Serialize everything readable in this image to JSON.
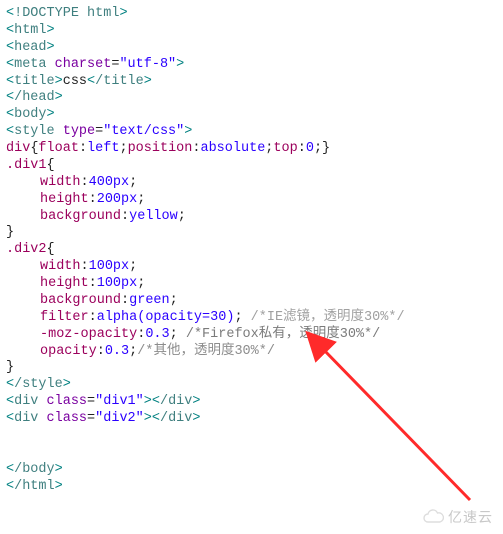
{
  "line01_a": "<",
  "line01_b": "!DOCTYPE html",
  "line01_c": ">",
  "line02_a": "<",
  "line02_b": "html",
  "line02_c": ">",
  "line03_a": "<",
  "line03_b": "head",
  "line03_c": ">",
  "line04_a": "<",
  "line04_b": "meta ",
  "line04_c": "charset",
  "line04_d": "=",
  "line04_e": "\"utf-8\"",
  "line04_f": ">",
  "line05_a": "<",
  "line05_b": "title",
  "line05_c": ">",
  "line05_d": "css",
  "line05_e": "<",
  "line05_f": "/title",
  "line05_g": ">",
  "line06_a": "<",
  "line06_b": "/head",
  "line06_c": ">",
  "line07_a": "<",
  "line07_b": "body",
  "line07_c": ">",
  "line08_a": "<",
  "line08_b": "style ",
  "line08_c": "type",
  "line08_d": "=",
  "line08_e": "\"text/css\"",
  "line08_f": ">",
  "line09_a": "div",
  "line09_b": "{",
  "line09_c": "float",
  "line09_d": ":",
  "line09_e": "left",
  "line09_f": ";",
  "line09_g": "position",
  "line09_h": ":",
  "line09_i": "absolute",
  "line09_j": ";",
  "line09_k": "top",
  "line09_l": ":",
  "line09_m": "0",
  "line09_n": ";}",
  "line10_a": ".div1",
  "line10_b": "{",
  "line11_a": "width",
  "line11_b": ":",
  "line11_c": "400px",
  "line11_d": ";",
  "line12_a": "height",
  "line12_b": ":",
  "line12_c": "200px",
  "line12_d": ";",
  "line13_a": "background",
  "line13_b": ":",
  "line13_c": "yellow",
  "line13_d": ";",
  "line14_a": "}",
  "line15_a": ".div2",
  "line15_b": "{",
  "line16_a": "width",
  "line16_b": ":",
  "line16_c": "100px",
  "line16_d": ";",
  "line17_a": "height",
  "line17_b": ":",
  "line17_c": "100px",
  "line17_d": ";",
  "line18_a": "background",
  "line18_b": ":",
  "line18_c": "green",
  "line18_d": ";",
  "line19_a": "filter",
  "line19_b": ":",
  "line19_c": "alpha(opacity=30)",
  "line19_d": "; ",
  "line19_e": "/*IE滤镜，透明度30%*/",
  "line20_a": "-moz-opacity",
  "line20_b": ":",
  "line20_c": "0.3",
  "line20_d": "; ",
  "line20_e": "/*Firefox私有，透明度30%*/",
  "line21_a": "opacity",
  "line21_b": ":",
  "line21_c": "0.3",
  "line21_d": ";",
  "line21_e": "/*其他，透明度30%*/",
  "line22_a": "}",
  "line23_a": "<",
  "line23_b": "/style",
  "line23_c": ">",
  "blank": "",
  "line25_a": "<",
  "line25_b": "div ",
  "line25_c": "class",
  "line25_d": "=",
  "line25_e": "\"div1\"",
  "line25_f": ">",
  "line25_g": "<",
  "line25_h": "/div",
  "line25_i": ">",
  "line26_a": "<",
  "line26_b": "div ",
  "line26_c": "class",
  "line26_d": "=",
  "line26_e": "\"div2\"",
  "line26_f": ">",
  "line26_g": "<",
  "line26_h": "/div",
  "line26_i": ">",
  "line28_a": "<",
  "line28_b": "/body",
  "line28_c": ">",
  "line29_a": "<",
  "line29_b": "/html",
  "line29_c": ">",
  "watermark_text": "亿速云"
}
